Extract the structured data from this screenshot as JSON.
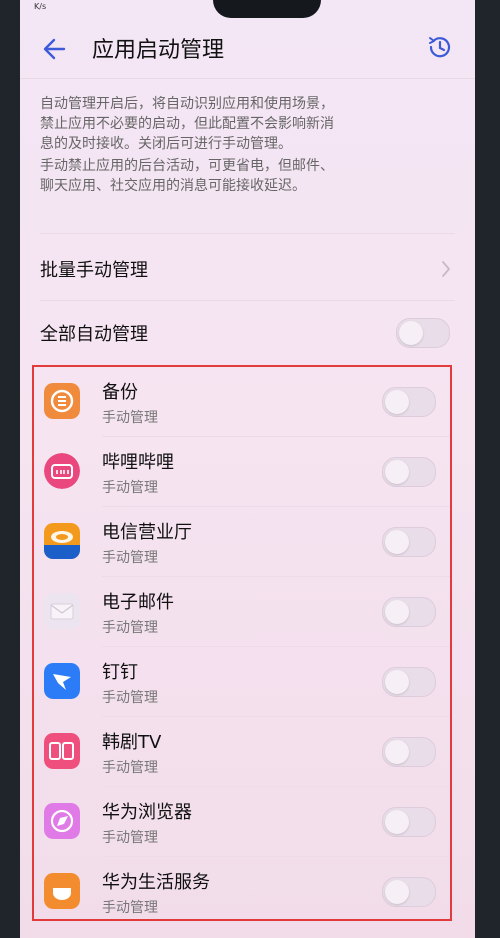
{
  "status": {
    "left": "K/s",
    "right": ""
  },
  "header": {
    "title": "应用启动管理"
  },
  "description": {
    "para1": [
      "自动管理开启后，将自动识别应用和使用场景，",
      "禁止应用不必要的启动，但此配置不会影响新消",
      "息的及时接收。关闭后可进行手动管理。"
    ],
    "para2": [
      "手动禁止应用的后台活动，可更省电，但邮件、",
      "聊天应用、社交应用的消息可能接收延迟。"
    ]
  },
  "menu": {
    "batch_label": "批量手动管理",
    "auto_all_label": "全部自动管理",
    "auto_all_enabled": false
  },
  "apps": [
    {
      "name": "备份",
      "status": "手动管理",
      "icon": "backup-icon",
      "enabled": false
    },
    {
      "name": "哔哩哔哩",
      "status": "手动管理",
      "icon": "bilibili-icon",
      "enabled": false
    },
    {
      "name": "电信营业厅",
      "status": "手动管理",
      "icon": "telecom-icon",
      "enabled": false
    },
    {
      "name": "电子邮件",
      "status": "手动管理",
      "icon": "email-icon",
      "enabled": false
    },
    {
      "name": "钉钉",
      "status": "手动管理",
      "icon": "dingtalk-icon",
      "enabled": false
    },
    {
      "name": "韩剧TV",
      "status": "手动管理",
      "icon": "hanjutv-icon",
      "enabled": false
    },
    {
      "name": "华为浏览器",
      "status": "手动管理",
      "icon": "huawei-browser-icon",
      "enabled": false
    },
    {
      "name": "华为生活服务",
      "status": "手动管理",
      "icon": "huawei-life-icon",
      "enabled": false
    }
  ],
  "colors": {
    "accent": "#3d5bd9",
    "highlight_border": "#e23b3b",
    "background": "#f5e3f1"
  }
}
